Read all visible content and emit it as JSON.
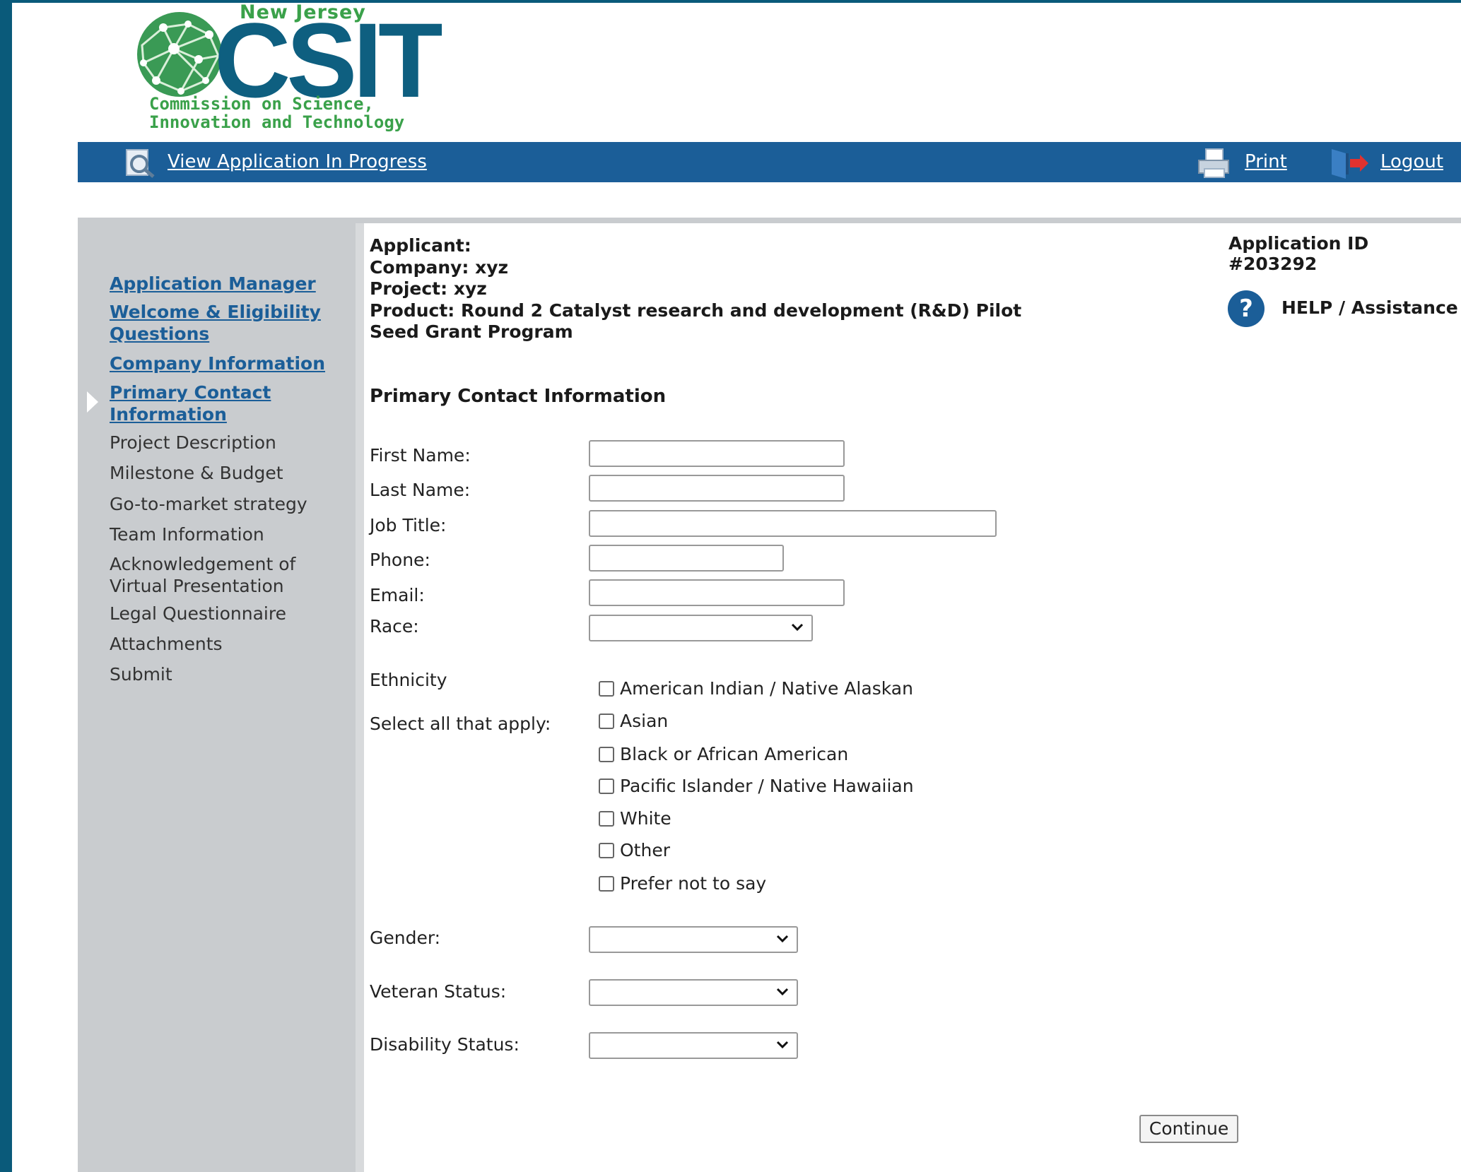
{
  "logo": {
    "top_text": "New Jersey",
    "main_text": "CSIT",
    "subtitle_line1": "Commission on Science,",
    "subtitle_line2": "Innovation and Technology"
  },
  "toolbar": {
    "view_application": "View Application In Progress",
    "print": "Print",
    "logout": "Logout"
  },
  "sidebar": {
    "items": [
      {
        "label": "Application Manager",
        "link": true
      },
      {
        "label": "Welcome & Eligibility Questions",
        "link": true
      },
      {
        "label": "Company Information",
        "link": true
      },
      {
        "label": "Primary Contact Information",
        "link": true,
        "current": true
      },
      {
        "label": "Project Description",
        "link": false
      },
      {
        "label": "Milestone & Budget",
        "link": false
      },
      {
        "label": "Go-to-market strategy",
        "link": false
      },
      {
        "label": "Team Information",
        "link": false
      },
      {
        "label": "Acknowledgement of Virtual Presentation",
        "link": false
      },
      {
        "label": "Legal Questionnaire",
        "link": false
      },
      {
        "label": "Attachments",
        "link": false
      },
      {
        "label": "Submit",
        "link": false
      }
    ]
  },
  "header": {
    "applicant": "Applicant:",
    "company": "Company: xyz",
    "project": "Project: xyz",
    "product_line1": "Product: Round 2 Catalyst research and development (R&D) Pilot",
    "product_line2": "Seed Grant Program",
    "application_id": "Application ID #203292",
    "help": "HELP / Assistance"
  },
  "form": {
    "section_title": "Primary Contact Information",
    "first_name_label": "First Name:",
    "first_name_value": "",
    "last_name_label": "Last Name:",
    "last_name_value": "",
    "job_title_label": "Job Title:",
    "job_title_value": "",
    "phone_label": "Phone:",
    "phone_value": "",
    "email_label": "Email:",
    "email_value": "",
    "race_label": "Race:",
    "race_value": "",
    "ethnicity_label": "Ethnicity",
    "ethnicity_hint": "Select all that apply:",
    "ethnicity_options": [
      "American Indian / Native Alaskan",
      "Asian",
      "Black or African American",
      "Pacific Islander / Native Hawaiian",
      "White",
      "Other",
      "Prefer not to say"
    ],
    "gender_label": "Gender:",
    "gender_value": "",
    "veteran_label": "Veteran Status:",
    "veteran_value": "",
    "disability_label": "Disability Status:",
    "disability_value": "",
    "continue_label": "Continue"
  }
}
